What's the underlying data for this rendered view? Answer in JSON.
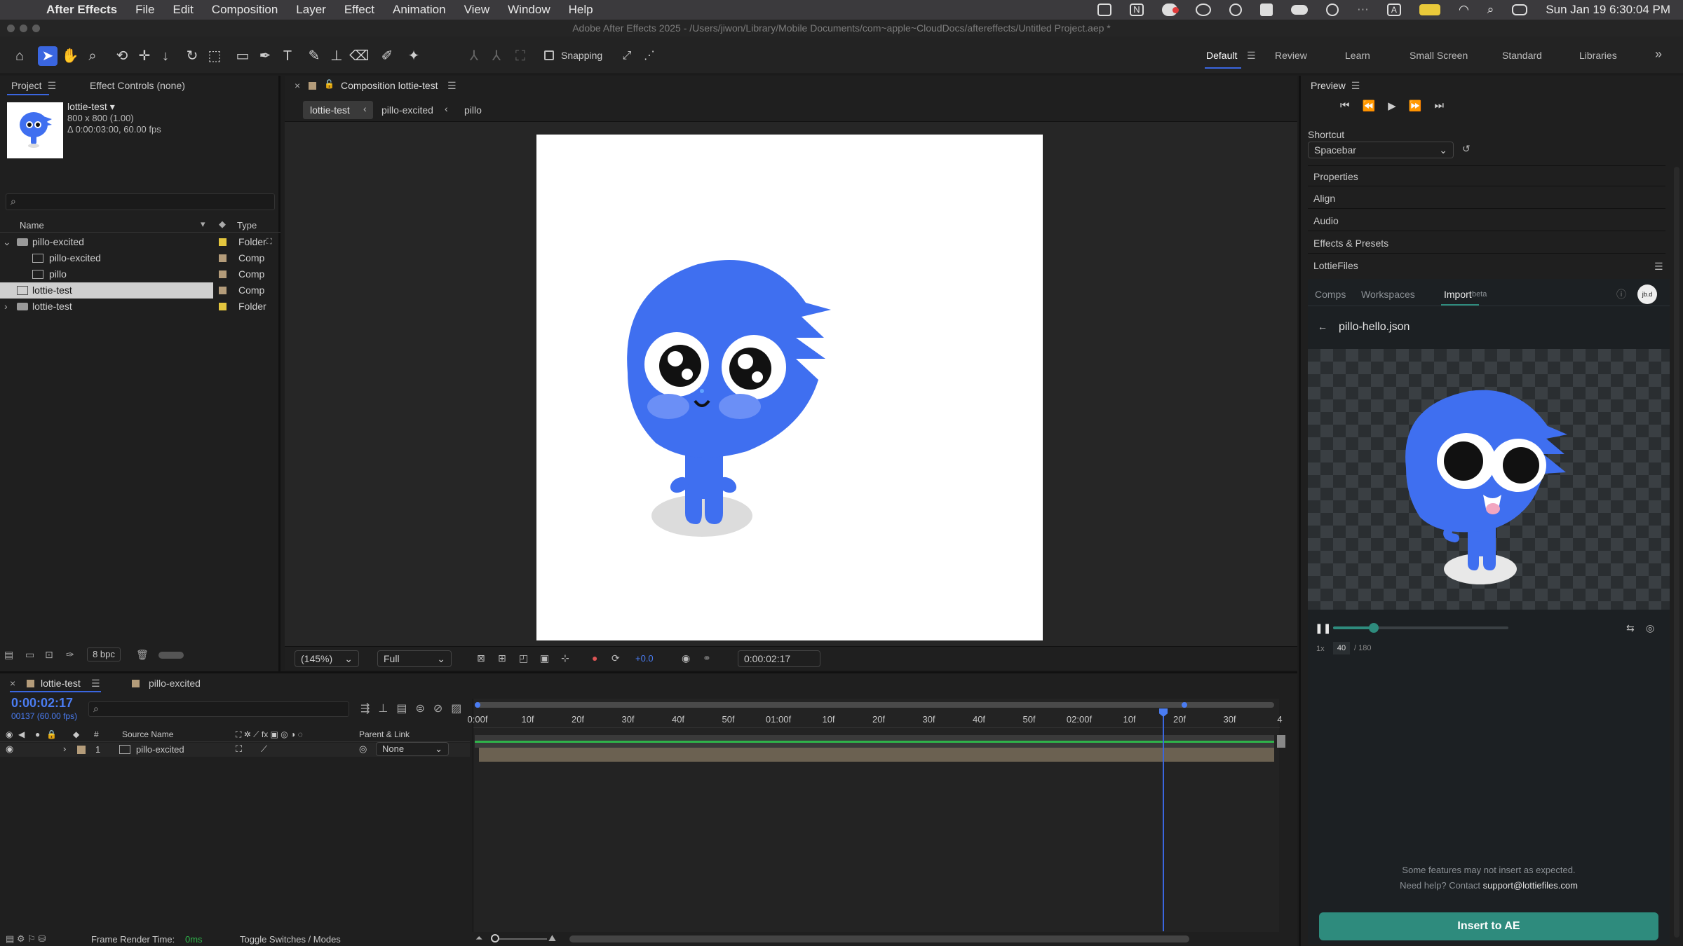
{
  "menubar": {
    "app": "After Effects",
    "items": [
      "File",
      "Edit",
      "Composition",
      "Layer",
      "Effect",
      "Animation",
      "View",
      "Window",
      "Help"
    ],
    "datetime": "Sun Jan 19  6:30:04 PM"
  },
  "window": {
    "title": "Adobe After Effects 2025 - /Users/jiwon/Library/Mobile Documents/com~apple~CloudDocs/aftereffects/Untitled Project.aep *"
  },
  "toolbar": {
    "snapping": "Snapping",
    "workspaces": [
      "Default",
      "Review",
      "Learn",
      "Small Screen",
      "Standard",
      "Libraries"
    ]
  },
  "project": {
    "tab": "Project",
    "effect_tab": "Effect Controls (none)",
    "item_name": "lottie-test ▾",
    "item_dims": "800 x 800 (1.00)",
    "item_duration": "Δ 0:00:03:00, 60.00 fps",
    "search_placeholder": "",
    "col_name": "Name",
    "col_type": "Type",
    "rows": [
      {
        "name": "pillo-excited",
        "type": "Folder"
      },
      {
        "name": "pillo-excited",
        "type": "Comp"
      },
      {
        "name": "pillo",
        "type": "Comp"
      },
      {
        "name": "lottie-test",
        "type": "Comp"
      },
      {
        "name": "lottie-test",
        "type": "Folder"
      }
    ],
    "bpc": "8 bpc"
  },
  "viewer": {
    "tab": "Composition lottie-test",
    "breadcrumbs": [
      "lottie-test",
      "pillo-excited",
      "pillo"
    ],
    "zoom": "(145%)",
    "resolution": "Full",
    "exposure": "+0.0",
    "timecode": "0:00:02:17"
  },
  "preview": {
    "title": "Preview",
    "shortcut_label": "Shortcut",
    "shortcut_value": "Spacebar",
    "panels": [
      "Properties",
      "Align",
      "Audio",
      "Effects & Presets"
    ]
  },
  "lottie": {
    "title": "LottieFiles",
    "tabs": [
      "Comps",
      "Workspaces",
      "Import"
    ],
    "beta": "beta",
    "avatar": "jb.d",
    "file": "pillo-hello.json",
    "speed": "1x",
    "frame": "40",
    "total": "/ 180",
    "progress": 0.23,
    "note1": "Some features may not insert as expected.",
    "note2": "Need help? Contact ",
    "email": "support@lottiefiles.com",
    "insert": "Insert to AE"
  },
  "timeline": {
    "tabs": [
      "lottie-test",
      "pillo-excited"
    ],
    "timecode": "0:00:02:17",
    "sub": "00137 (60.00 fps)",
    "col_source": "Source Name",
    "col_parent": "Parent & Link",
    "layer": {
      "num": "1",
      "name": "pillo-excited",
      "parent": "None"
    },
    "ticks": [
      "0:00f",
      "10f",
      "20f",
      "30f",
      "40f",
      "50f",
      "01:00f",
      "10f",
      "20f",
      "30f",
      "40f",
      "50f",
      "02:00f",
      "10f",
      "20f",
      "30f",
      "4"
    ]
  },
  "status": {
    "render_label": "Frame Render Time:",
    "render_value": "0ms",
    "toggle": "Toggle Switches / Modes"
  },
  "colors": {
    "accent": "#3a66e0",
    "lottie_teal": "#2e8b7d",
    "mascot": "#3f6ff0",
    "green_bar": "#2fb34a",
    "layer_bar": "#6b6151"
  }
}
